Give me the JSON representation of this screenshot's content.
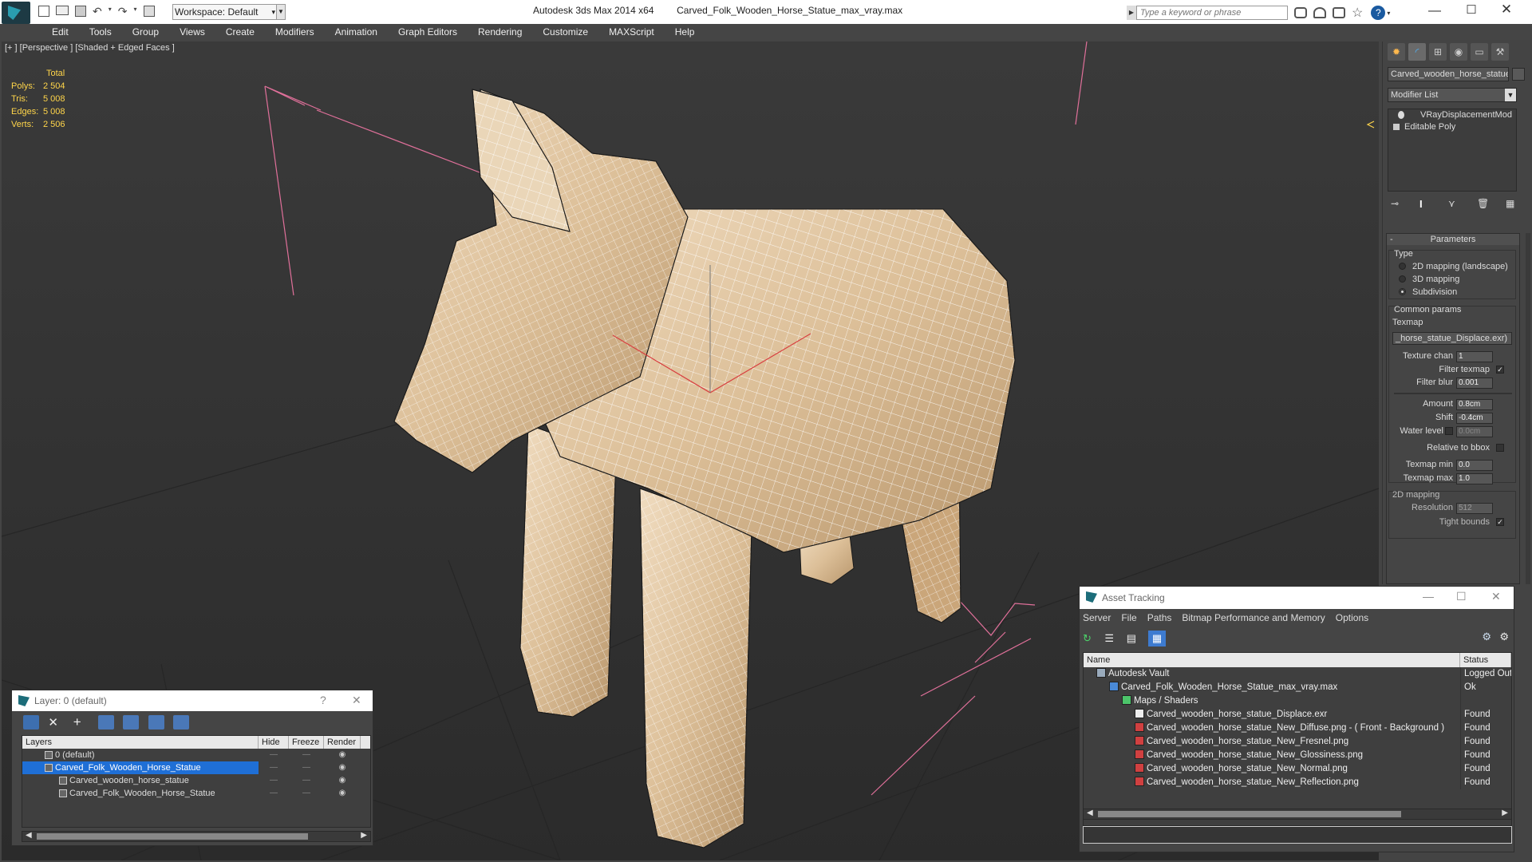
{
  "window": {
    "app_title": "Autodesk 3ds Max  2014 x64",
    "file_title": "Carved_Folk_Wooden_Horse_Statue_max_vray.max",
    "workspace": "Workspace: Default",
    "search_placeholder": "Type a keyword or phrase"
  },
  "menu": [
    "Edit",
    "Tools",
    "Group",
    "Views",
    "Create",
    "Modifiers",
    "Animation",
    "Graph Editors",
    "Rendering",
    "Customize",
    "MAXScript",
    "Help"
  ],
  "viewport": {
    "label": "[+ ] [Perspective ] [Shaded + Edged Faces ]",
    "stats_header": "Total",
    "stats": [
      {
        "k": "Polys:",
        "v": "2 504"
      },
      {
        "k": "Tris:",
        "v": "5 008"
      },
      {
        "k": "Edges:",
        "v": "5 008"
      },
      {
        "k": "Verts:",
        "v": "2 506"
      }
    ]
  },
  "command_panel": {
    "object_name": "Carved_wooden_horse_statue",
    "modifier_list": "Modifier List",
    "stack": [
      "VRayDisplacementMod",
      "Editable Poly"
    ],
    "rollout_title": "Parameters",
    "type_label": "Type",
    "type_options": [
      {
        "label": "2D mapping (landscape)",
        "on": false
      },
      {
        "label": "3D mapping",
        "on": false
      },
      {
        "label": "Subdivision",
        "on": true
      }
    ],
    "common_params": "Common params",
    "texmap_label": "Texmap",
    "texmap_value": "_horse_statue_Displace.exr)",
    "texture_chan_label": "Texture chan",
    "texture_chan": "1",
    "filter_texmap": "Filter texmap",
    "filter_blur_label": "Filter blur",
    "filter_blur": "0.001",
    "amount_label": "Amount",
    "amount": "0.8cm",
    "shift_label": "Shift",
    "shift": "-0.4cm",
    "water_level_label": "Water level",
    "water_level": "0.0cm",
    "relative_bbox": "Relative to bbox",
    "texmap_min_label": "Texmap min",
    "texmap_min": "0.0",
    "texmap_max_label": "Texmap max",
    "texmap_max": "1.0",
    "mapping_2d": "2D mapping",
    "resolution_label": "Resolution",
    "resolution": "512",
    "tight_bounds": "Tight bounds"
  },
  "layer_panel": {
    "title": "Layer: 0 (default)",
    "help": "?",
    "headers": [
      "Layers",
      "Hide",
      "Freeze",
      "Render"
    ],
    "rows": [
      {
        "name": "0 (default)",
        "selected": false,
        "indent": 1
      },
      {
        "name": "Carved_Folk_Wooden_Horse_Statue",
        "selected": true,
        "indent": 1
      },
      {
        "name": "Carved_wooden_horse_statue",
        "selected": false,
        "indent": 2
      },
      {
        "name": "Carved_Folk_Wooden_Horse_Statue",
        "selected": false,
        "indent": 2
      }
    ]
  },
  "asset_panel": {
    "title": "Asset Tracking",
    "menu": [
      "Server",
      "File",
      "Paths",
      "Bitmap Performance and Memory",
      "Options"
    ],
    "headers": [
      "Name",
      "Status"
    ],
    "rows": [
      {
        "name": "Autodesk Vault",
        "status": "Logged Out",
        "indent": 1,
        "icon": "vault"
      },
      {
        "name": "Carved_Folk_Wooden_Horse_Statue_max_vray.max",
        "status": "Ok",
        "indent": 2,
        "icon": "max"
      },
      {
        "name": "Maps / Shaders",
        "status": "",
        "indent": 3,
        "icon": "folder"
      },
      {
        "name": "Carved_wooden_horse_statue_Displace.exr",
        "status": "Found",
        "indent": 4,
        "icon": "exr"
      },
      {
        "name": "Carved_wooden_horse_statue_New_Diffuse.png -  ( Front - Background )",
        "status": "Found",
        "indent": 4,
        "icon": "png"
      },
      {
        "name": "Carved_wooden_horse_statue_New_Fresnel.png",
        "status": "Found",
        "indent": 4,
        "icon": "png"
      },
      {
        "name": "Carved_wooden_horse_statue_New_Glossiness.png",
        "status": "Found",
        "indent": 4,
        "icon": "png"
      },
      {
        "name": "Carved_wooden_horse_statue_New_Normal.png",
        "status": "Found",
        "indent": 4,
        "icon": "png"
      },
      {
        "name": "Carved_wooden_horse_statue_New_Reflection.png",
        "status": "Found",
        "indent": 4,
        "icon": "png"
      }
    ]
  },
  "colors": {
    "accent": "#1c6d7a",
    "stats": "#ffd54a",
    "selection": "#1f6fd6",
    "wood": "#e4c9a4"
  }
}
